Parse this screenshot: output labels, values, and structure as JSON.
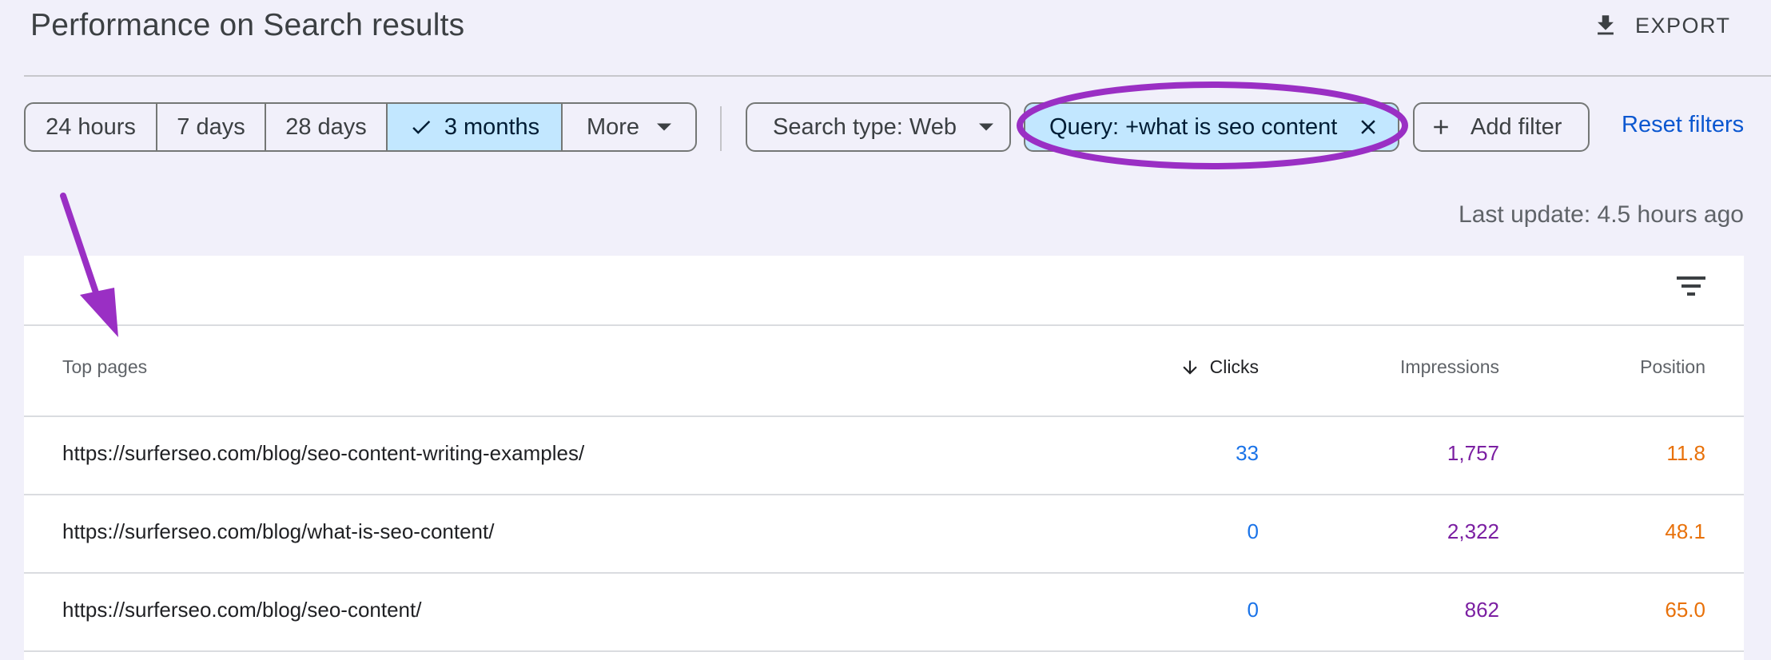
{
  "header": {
    "title": "Performance on Search results",
    "export_label": "EXPORT",
    "export_icon": "download-icon"
  },
  "date_range": {
    "options": [
      {
        "label": "24 hours",
        "selected": false
      },
      {
        "label": "7 days",
        "selected": false
      },
      {
        "label": "28 days",
        "selected": false
      },
      {
        "label": "3 months",
        "selected": true
      },
      {
        "label": "More",
        "selected": false
      }
    ]
  },
  "filters": {
    "search_type": "Search type: Web",
    "query": "Query: +what is seo content",
    "add_filter": "Add filter",
    "reset": "Reset filters"
  },
  "last_update": "Last update: 4.5 hours ago",
  "table": {
    "columns": {
      "page": "Top pages",
      "clicks": "Clicks",
      "impressions": "Impressions",
      "position": "Position"
    },
    "sort": {
      "column": "clicks",
      "direction": "descending"
    },
    "rows": [
      {
        "url": "https://surferseo.com/blog/seo-content-writing-examples/",
        "clicks": "33",
        "impressions": "1,757",
        "position": "11.8"
      },
      {
        "url": "https://surferseo.com/blog/what-is-seo-content/",
        "clicks": "0",
        "impressions": "2,322",
        "position": "48.1"
      },
      {
        "url": "https://surferseo.com/blog/seo-content/",
        "clicks": "0",
        "impressions": "862",
        "position": "65.0"
      }
    ]
  },
  "colors": {
    "background": "#f1f0fa",
    "selected_chip": "#c2e7ff",
    "link": "#0b57d0",
    "clicks": "#1a73e8",
    "impressions": "#7b1fa2",
    "position": "#e8710a",
    "annotation": "#9a2fc4"
  }
}
